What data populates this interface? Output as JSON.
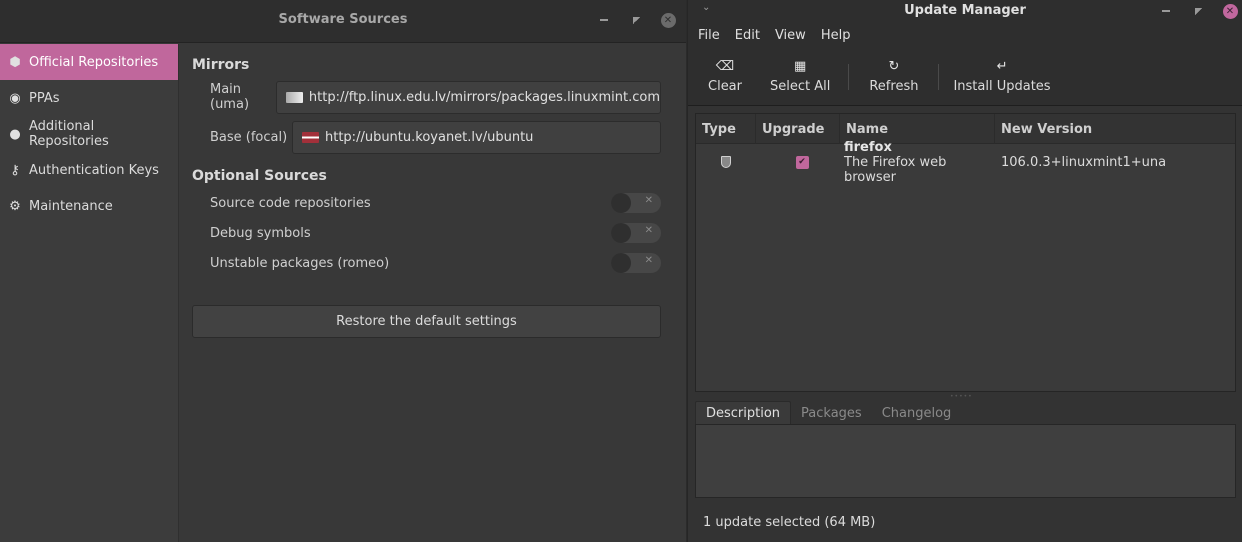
{
  "software_sources": {
    "title": "Software Sources",
    "window_buttons": {
      "minimize": "minimize",
      "maximize": "maximize",
      "close": "close"
    },
    "sidebar": {
      "items": [
        {
          "label": "Official Repositories",
          "icon": "package-box-icon",
          "active": true
        },
        {
          "label": "PPAs",
          "icon": "ppa-target-icon",
          "active": false
        },
        {
          "label": "Additional Repositories",
          "icon": "globe-icon",
          "active": false
        },
        {
          "label": "Authentication Keys",
          "icon": "key-icon",
          "active": false
        },
        {
          "label": "Maintenance",
          "icon": "maintenance-tools-icon",
          "active": false
        }
      ]
    },
    "mirrors": {
      "heading": "Mirrors",
      "main_label": "Main (uma)",
      "main_value": "http://ftp.linux.edu.lv/mirrors/packages.linuxmint.com",
      "base_label": "Base (focal)",
      "base_value": "http://ubuntu.koyanet.lv/ubuntu"
    },
    "optional": {
      "heading": "Optional Sources",
      "items": [
        {
          "label": "Source code repositories",
          "enabled": false
        },
        {
          "label": "Debug symbols",
          "enabled": false
        },
        {
          "label": "Unstable packages (romeo)",
          "enabled": false
        }
      ]
    },
    "restore_label": "Restore the default settings"
  },
  "update_manager": {
    "title": "Update Manager",
    "menu": [
      "File",
      "Edit",
      "View",
      "Help"
    ],
    "toolbar": {
      "clear": "Clear",
      "select_all": "Select All",
      "refresh": "Refresh",
      "install": "Install Updates"
    },
    "table": {
      "columns": [
        "Type",
        "Upgrade",
        "Name",
        "New Version"
      ],
      "rows": [
        {
          "type": "security-shield",
          "upgrade": true,
          "name": "firefox",
          "description": "The Firefox web browser",
          "version": "106.0.3+linuxmint1+una"
        }
      ]
    },
    "tabs": [
      "Description",
      "Packages",
      "Changelog"
    ],
    "active_tab": "Description",
    "status": "1 update selected (64 MB)",
    "accent": "#c0679c"
  }
}
